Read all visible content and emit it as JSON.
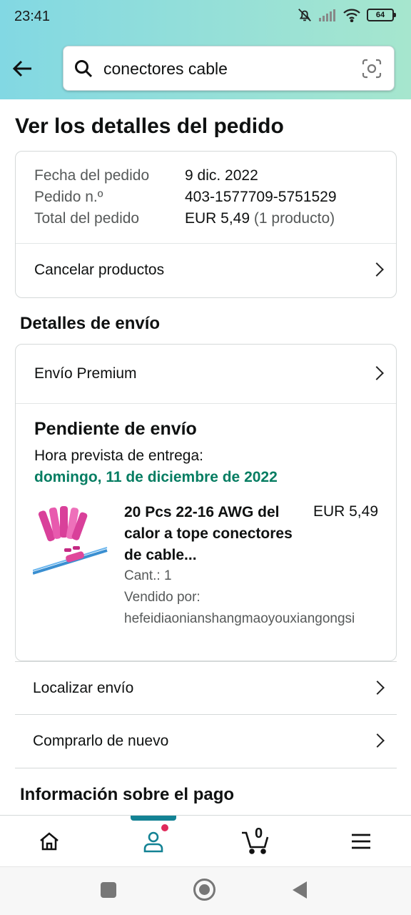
{
  "status_bar": {
    "time": "23:41",
    "battery": "64"
  },
  "search": {
    "query": "conectores cable"
  },
  "page": {
    "title": "Ver los detalles del pedido"
  },
  "order": {
    "date_label": "Fecha del pedido",
    "date_value": "9 dic. 2022",
    "number_label": "Pedido n.º",
    "number_value": "403-1577709-5751529",
    "total_label": "Total del pedido",
    "total_value": "EUR 5,49",
    "total_count": "(1 producto)",
    "cancel_label": "Cancelar productos"
  },
  "shipping": {
    "section_title": "Detalles de envío",
    "method": "Envío Premium",
    "status_title": "Pendiente de envío",
    "eta_label": "Hora prevista de entrega:",
    "eta_date": "domingo, 11 de diciembre de 2022",
    "product": {
      "title": "20 Pcs 22-16 AWG del calor a tope conectores de cable...",
      "price": "EUR 5,49",
      "qty": "Cant.: 1",
      "seller_label": "Vendido por:",
      "seller": "hefeidiaonianshangmaoyouxiangongsi"
    }
  },
  "actions": {
    "track": "Localizar envío",
    "buy_again": "Comprarlo de nuevo"
  },
  "payment": {
    "section_title": "Información sobre el pago"
  },
  "nav": {
    "cart_count": "0"
  },
  "colors": {
    "accent": "#138294",
    "green": "#067d62",
    "badge": "#e02a5a"
  }
}
